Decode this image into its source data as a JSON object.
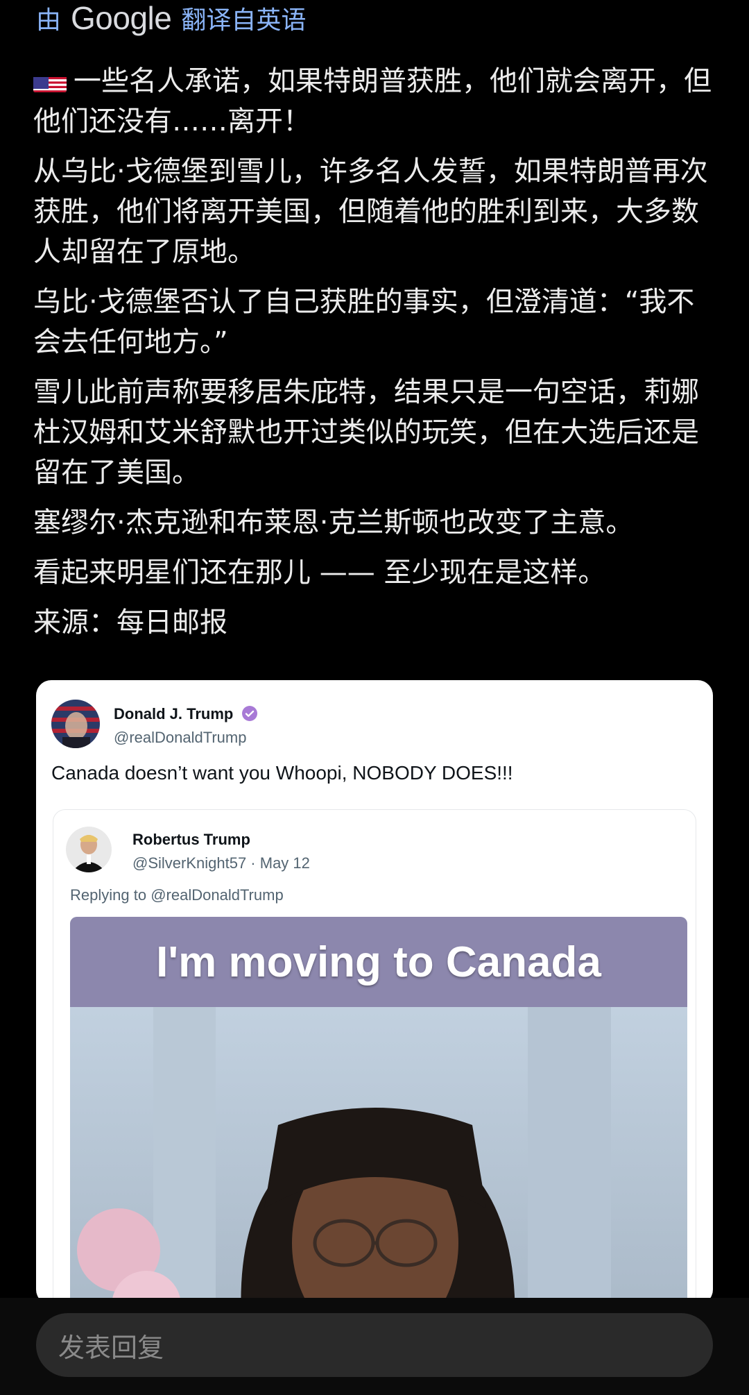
{
  "translate": {
    "prefix": "由",
    "brand": "Google",
    "suffix": "翻译自英语"
  },
  "post": {
    "flag_icon": "us-flag-icon",
    "paragraphs": [
      "一些名人承诺，如果特朗普获胜，他们就会离开，但他们还没有……离开！",
      "从乌比·戈德堡到雪儿，许多名人发誓，如果特朗普再次获胜，他们将离开美国，但随着他的胜利到来，大多数人却留在了原地。",
      "乌比·戈德堡否认了自己获胜的事实，但澄清道：“我不会去任何地方。”",
      "雪儿此前声称要移居朱庇特，结果只是一句空话，莉娜杜汉姆和艾米舒默也开过类似的玩笑，但在大选后还是留在了美国。",
      "塞缪尔·杰克逊和布莱恩·克兰斯顿也改变了主意。",
      "看起来明星们还在那儿 —— 至少现在是这样。",
      "来源：每日邮报"
    ]
  },
  "tweet": {
    "name": "Donald J. Trump",
    "handle": "@realDonaldTrump",
    "verified_icon": "verified-badge-icon",
    "text": "Canada doesn’t want you Whoopi, NOBODY DOES!!!",
    "quoted": {
      "name": "Robertus Trump",
      "handle_date": "@SilverKnight57 · May 12",
      "reply_prefix": "Replying to",
      "reply_to": "@realDonaldTrump",
      "meme_caption": "I'm moving to Canada"
    }
  },
  "reply_box": {
    "placeholder": "发表回复"
  },
  "colors": {
    "background": "#000000",
    "link_blue": "#8ab4f8",
    "verified_purple": "#a87ad6",
    "meme_band": "#8c87ad"
  }
}
